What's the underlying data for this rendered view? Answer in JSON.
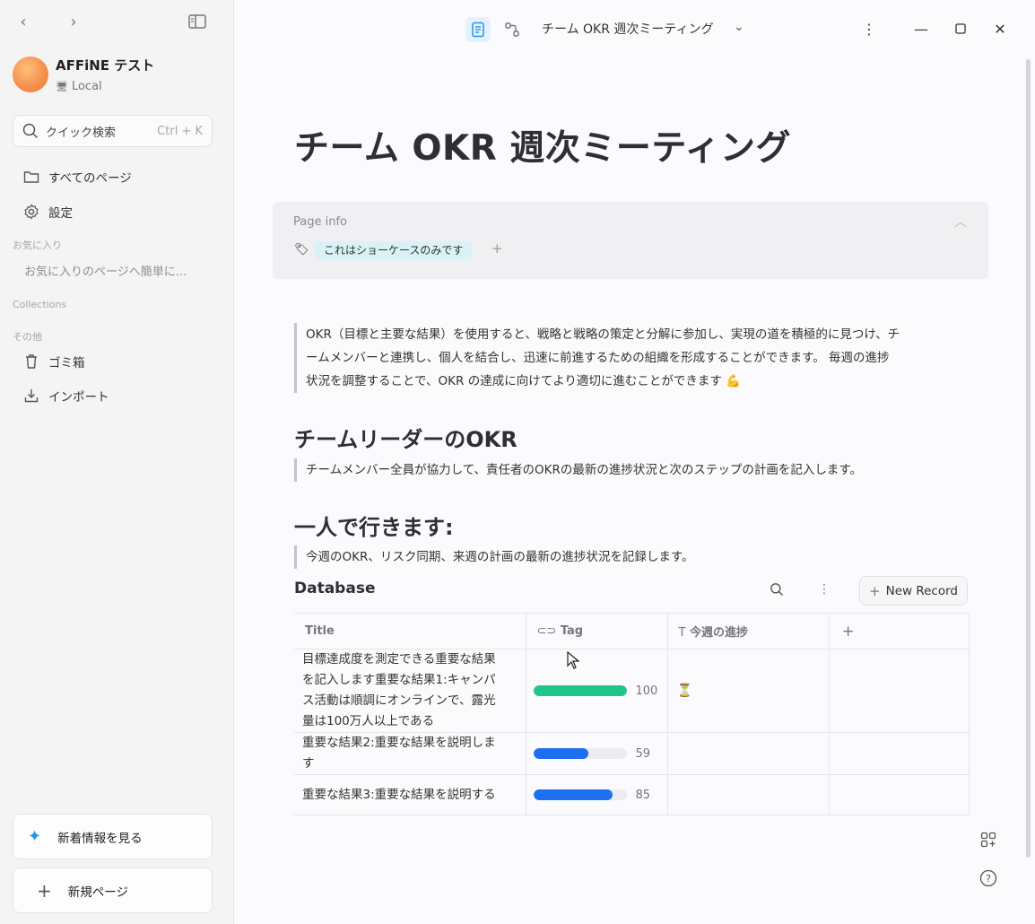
{
  "sidebar": {
    "workspace_name": "AFFiNE テスト",
    "workspace_location": "Local",
    "search_label": "クイック検索",
    "search_shortcut": "Ctrl + K",
    "nav_all_pages": "すべてのページ",
    "nav_settings": "設定",
    "favorites_header": "お気に入り",
    "favorites_empty": "お気に入りのページへ簡単に...",
    "collections_header": "Collections",
    "others_header": "その他",
    "nav_trash": "ゴミ箱",
    "nav_import": "インポート",
    "whats_new": "新着情報を見る",
    "new_page": "新規ページ"
  },
  "topbar": {
    "doc_title": "チーム OKR 週次ミーティング"
  },
  "doc": {
    "title": "チーム OKR 週次ミーティング",
    "page_info_label": "Page info",
    "tag": "これはショーケースのみです",
    "quote1_line1": "OKR（目標と主要な結果）を使用すると、戦略と戦略の策定と分解に参加し、実現の道を積極的に見つけ、チ",
    "quote1_line2": "ームメンバーと連携し、個人を結合し、迅速に前進するための組織を形成することができます。 毎週の進捗",
    "quote1_line3": "状況を調整することで、OKR の達成に向けてより適切に進むことができます 💪",
    "h2_leader": "チームリーダーのOKR",
    "quote2": "チームメンバー全員が協力して、責任者のOKRの最新の進捗状況と次のステップの計画を記入します。",
    "h2_solo": "一人で行きます:",
    "quote3": "今週のOKR、リスク同期、来週の計画の最新の進捗状況を記録します。"
  },
  "database": {
    "title": "Database",
    "new_record": "New Record",
    "columns": {
      "title": "Title",
      "tag": "Tag",
      "progress_note": "今週の進捗"
    },
    "rows": [
      {
        "title_line1": "目標達成度を測定できる重要な結果",
        "title_line2": "を記入します重要な結果1:キャンパ",
        "title_line3": "ス活動は順調にオンラインで、露光",
        "title_line4": "量は100万人以上である",
        "progress": "100",
        "note": "⏳"
      },
      {
        "title_line1": "重要な結果2:重要な結果を説明しま",
        "title_line2": "す",
        "progress": "59"
      },
      {
        "title_line1": "重要な結果3:重要な結果を説明する",
        "progress": "85"
      }
    ]
  },
  "colors": {
    "progress_complete": "#1fc68a",
    "progress_partial": "#1e6ff0",
    "tag_bg": "#d9f2f6",
    "avatar": "#f38d4a"
  }
}
